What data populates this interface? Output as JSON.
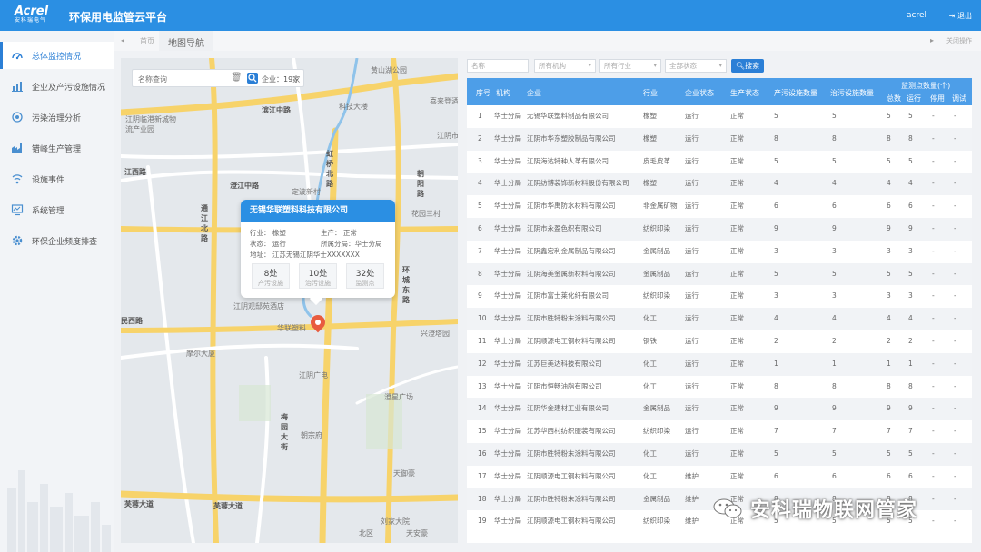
{
  "header": {
    "logo_text": "Acrel",
    "logo_sub": "安科瑞电气",
    "title": "环保用电监管云平台",
    "user": "acrel",
    "logout": "退出"
  },
  "sidebar": {
    "items": [
      {
        "label": "总体监控情况",
        "icon": "monitor-icon",
        "active": true
      },
      {
        "label": "企业及产污设施情况",
        "icon": "factory-chart-icon"
      },
      {
        "label": "污染治理分析",
        "icon": "target-gear-icon"
      },
      {
        "label": "错峰生产管理",
        "icon": "industry-icon"
      },
      {
        "label": "设施事件",
        "icon": "signal-icon"
      },
      {
        "label": "系统管理",
        "icon": "screen-chart-icon"
      },
      {
        "label": "环保企业频度排查",
        "icon": "gear-icon"
      }
    ]
  },
  "tabs": {
    "prev": "◂",
    "home": "首页",
    "active": "地图导航",
    "next": "▸",
    "close": "关闭操作"
  },
  "map": {
    "search_placeholder": "名称查询",
    "company_count": "企业：19家",
    "pois": [
      {
        "label": "黄山湖公园",
        "road": false
      },
      {
        "label": "滨江中路",
        "road": true
      },
      {
        "label": "科技大楼",
        "road": false
      },
      {
        "label": "江阴临港新城物流产业园",
        "road": false
      },
      {
        "label": "江阴市",
        "road": false
      },
      {
        "label": "喜来登酒店",
        "road": false
      },
      {
        "label": "江西路",
        "road": true
      },
      {
        "label": "虹桥北路",
        "road": true
      },
      {
        "label": "朝阳路",
        "road": true
      },
      {
        "label": "澄江中路",
        "road": true
      },
      {
        "label": "定波新村",
        "road": false
      },
      {
        "label": "花园三村",
        "road": false
      },
      {
        "label": "通江北路",
        "road": true
      },
      {
        "label": "环城东路",
        "road": true
      },
      {
        "label": "江阴观邸苑酒店",
        "road": false
      },
      {
        "label": "华联塑料",
        "road": false
      },
      {
        "label": "民西路",
        "road": true
      },
      {
        "label": "兴澄塔园",
        "road": false
      },
      {
        "label": "摩尔大厦",
        "road": false
      },
      {
        "label": "江阴广电",
        "road": false
      },
      {
        "label": "澄星广场",
        "road": false
      },
      {
        "label": "梅园大街",
        "road": true
      },
      {
        "label": "朝宗府",
        "road": false
      },
      {
        "label": "天御豪",
        "road": false
      },
      {
        "label": "芙蓉大道",
        "road": true
      },
      {
        "label": "芙蓉大道",
        "road": true
      },
      {
        "label": "北区",
        "road": false
      },
      {
        "label": "刘家大院",
        "road": false
      },
      {
        "label": "天安豪",
        "road": false
      }
    ],
    "popup": {
      "title": "无锡华联塑料科技有限公司",
      "industry": "行业：  橡塑",
      "production": "生产：  正常",
      "status": "状态：  运行",
      "branch": "所属分局：华士分局",
      "address": "地址：  江苏无锡江阴华士XXXXXXX",
      "stats": [
        {
          "value": "8处",
          "label": "产污设施"
        },
        {
          "value": "10处",
          "label": "治污设施"
        },
        {
          "value": "32处",
          "label": "监测点"
        }
      ]
    }
  },
  "filters": {
    "name_placeholder": "名称",
    "org": "所有机构",
    "industry": "所有行业",
    "status": "全部状态",
    "search_button": "搜索"
  },
  "table": {
    "headers": {
      "index": "序号",
      "org": "机构",
      "company": "企业",
      "industry": "行业",
      "company_status": "企业状态",
      "production_status": "生产状态",
      "polluting_count": "产污设施数量",
      "treatment_count": "治污设施数量",
      "monitor_group": "监测点数量(个)",
      "total": "总数",
      "running": "运行",
      "stopped": "停用",
      "debug": "调试"
    },
    "rows": [
      [
        "1",
        "华士分局",
        "无锡华联塑料制品有限公司",
        "橡塑",
        "运行",
        "正常",
        "5",
        "5",
        "5",
        "5",
        "-",
        "-"
      ],
      [
        "2",
        "华士分局",
        "江阴市华东塑胶制品有限公司",
        "橡塑",
        "运行",
        "正常",
        "8",
        "8",
        "8",
        "8",
        "-",
        "-"
      ],
      [
        "3",
        "华士分局",
        "江阴海达特种人革有限公司",
        "皮毛皮革",
        "运行",
        "正常",
        "5",
        "5",
        "5",
        "5",
        "-",
        "-"
      ],
      [
        "4",
        "华士分局",
        "江阴纺博装饰新材料股份有限公司",
        "橡塑",
        "运行",
        "正常",
        "4",
        "4",
        "4",
        "4",
        "-",
        "-"
      ],
      [
        "5",
        "华士分局",
        "江阴市华禹防水材料有限公司",
        "非金属矿物",
        "运行",
        "正常",
        "6",
        "6",
        "6",
        "6",
        "-",
        "-"
      ],
      [
        "6",
        "华士分局",
        "江阴市永盈色织有限公司",
        "纺织印染",
        "运行",
        "正常",
        "9",
        "9",
        "9",
        "9",
        "-",
        "-"
      ],
      [
        "7",
        "华士分局",
        "江阴鑫宏利金属制品有限公司",
        "金属制品",
        "运行",
        "正常",
        "3",
        "3",
        "3",
        "3",
        "-",
        "-"
      ],
      [
        "8",
        "华士分局",
        "江阴海美金属新材料有限公司",
        "金属制品",
        "运行",
        "正常",
        "5",
        "5",
        "5",
        "5",
        "-",
        "-"
      ],
      [
        "9",
        "华士分局",
        "江阴市富士莱化纤有限公司",
        "纺织印染",
        "运行",
        "正常",
        "3",
        "3",
        "3",
        "3",
        "-",
        "-"
      ],
      [
        "10",
        "华士分局",
        "江阴市胜特粉末涂料有限公司",
        "化工",
        "运行",
        "正常",
        "4",
        "4",
        "4",
        "4",
        "-",
        "-"
      ],
      [
        "11",
        "华士分局",
        "江阴顺源电工钢材料有限公司",
        "钢铁",
        "运行",
        "正常",
        "2",
        "2",
        "2",
        "2",
        "-",
        "-"
      ],
      [
        "12",
        "华士分局",
        "江苏巨美达科技有限公司",
        "化工",
        "运行",
        "正常",
        "1",
        "1",
        "1",
        "1",
        "-",
        "-"
      ],
      [
        "13",
        "华士分局",
        "江阴市恒畅油脂有限公司",
        "化工",
        "运行",
        "正常",
        "8",
        "8",
        "8",
        "8",
        "-",
        "-"
      ],
      [
        "14",
        "华士分局",
        "江阴华金建材工业有限公司",
        "金属制品",
        "运行",
        "正常",
        "9",
        "9",
        "9",
        "9",
        "-",
        "-"
      ],
      [
        "15",
        "华士分局",
        "江苏华西村纺织服装有限公司",
        "纺织印染",
        "运行",
        "正常",
        "7",
        "7",
        "7",
        "7",
        "-",
        "-"
      ],
      [
        "16",
        "华士分局",
        "江阴市胜特粉末涂料有限公司",
        "化工",
        "运行",
        "正常",
        "5",
        "5",
        "5",
        "5",
        "-",
        "-"
      ],
      [
        "17",
        "华士分局",
        "江阴顺源电工钢材料有限公司",
        "化工",
        "维护",
        "正常",
        "6",
        "6",
        "6",
        "6",
        "-",
        "-"
      ],
      [
        "18",
        "华士分局",
        "江阴市胜特粉末涂料有限公司",
        "金属制品",
        "维护",
        "正常",
        "8",
        "8",
        "8",
        "8",
        "-",
        "-"
      ],
      [
        "19",
        "华士分局",
        "江阴顺源电工钢材料有限公司",
        "纺织印染",
        "维护",
        "正常",
        "5",
        "5",
        "5",
        "5",
        "-",
        "-"
      ]
    ]
  },
  "watermark": "安科瑞物联网管家",
  "colors": {
    "primary": "#2b8fe3",
    "table_header": "#4d9ee8",
    "marker": "#e85c3f",
    "map_bg": "#e4e8ec",
    "road": "#f7d36a"
  }
}
